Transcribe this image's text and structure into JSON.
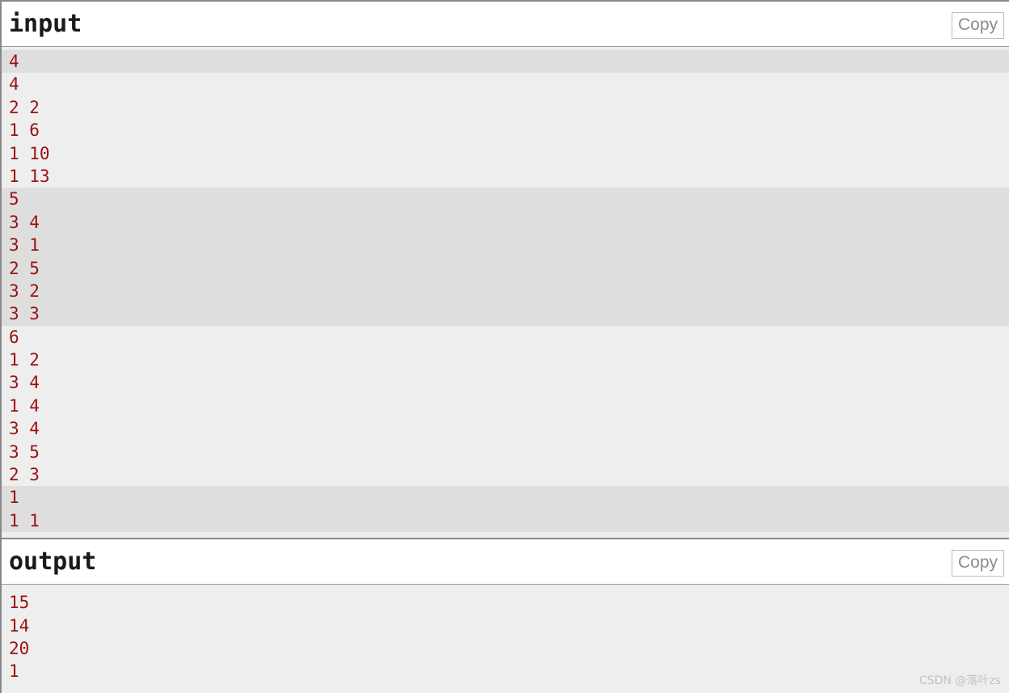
{
  "input_section": {
    "title": "input",
    "copy_label": "Copy",
    "blocks": [
      {
        "shaded": true,
        "lines": [
          "4"
        ]
      },
      {
        "shaded": false,
        "lines": [
          "4",
          "2 2",
          "1 6",
          "1 10",
          "1 13"
        ]
      },
      {
        "shaded": true,
        "lines": [
          "5",
          "3 4",
          "3 1",
          "2 5",
          "3 2",
          "3 3"
        ]
      },
      {
        "shaded": false,
        "lines": [
          "6",
          "1 2",
          "3 4",
          "1 4",
          "3 4",
          "3 5",
          "2 3"
        ]
      },
      {
        "shaded": true,
        "lines": [
          "1",
          "1 1"
        ]
      }
    ]
  },
  "output_section": {
    "title": "output",
    "copy_label": "Copy",
    "blocks": [
      {
        "shaded": false,
        "lines": [
          "15",
          "14",
          "20",
          "1"
        ]
      }
    ]
  },
  "watermark": {
    "text": "CSDN @落叶zs"
  },
  "colors": {
    "data_text": "#9b1111",
    "shaded_band": "#dedede",
    "plain_band": "#eeeeee",
    "border": "#888888",
    "copy_text": "#8c8c8c"
  }
}
